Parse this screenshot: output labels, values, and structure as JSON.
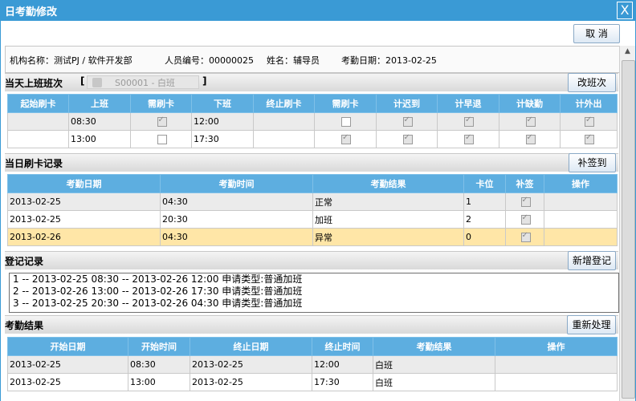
{
  "window": {
    "title": "日考勤修改",
    "close_glyph": "X"
  },
  "toolbar": {
    "cancel_label": "取 消"
  },
  "info": {
    "org": "机构名称：测试PJ / 软件开发部",
    "emp_no": "人员编号：00000025",
    "name": "姓名：辅导员",
    "date": "考勤日期：2013-02-25"
  },
  "shift": {
    "title": "当天上班班次",
    "bracket_open": "[",
    "value": "S00001 - 白班",
    "bracket_close": "]",
    "change_label": "改班次",
    "headers": [
      "起始刷卡",
      "上班",
      "需刷卡",
      "下班",
      "终止刷卡",
      "需刷卡",
      "计迟到",
      "计早退",
      "计缺勤",
      "计外出"
    ],
    "rows": [
      {
        "start_card": "",
        "on": "08:30",
        "need1": true,
        "off": "12:00",
        "end_card": "",
        "need2": false,
        "late": true,
        "early": true,
        "absent": true,
        "out": true
      },
      {
        "start_card": "",
        "on": "13:00",
        "need1": false,
        "off": "17:30",
        "end_card": "",
        "need2": true,
        "late": true,
        "early": true,
        "absent": true,
        "out": true
      }
    ]
  },
  "cards": {
    "title": "当日刷卡记录",
    "add_label": "补签到",
    "headers": [
      "考勤日期",
      "考勤时间",
      "考勤结果",
      "卡位",
      "补签",
      "操作"
    ],
    "rows": [
      {
        "date": "2013-02-25",
        "time": "04:30",
        "result": "正常",
        "slot": "1",
        "sup": true,
        "op": ""
      },
      {
        "date": "2013-02-25",
        "time": "20:30",
        "result": "加班",
        "slot": "2",
        "sup": true,
        "op": ""
      },
      {
        "date": "2013-02-26",
        "time": "04:30",
        "result": "异常",
        "slot": "0",
        "sup": true,
        "op": ""
      }
    ]
  },
  "register": {
    "title": "登记记录",
    "add_label": "新增登记",
    "items": [
      "1 -- 2013-02-25 08:30 -- 2013-02-26 12:00 申请类型:普通加班",
      "2 -- 2013-02-26 13:00 -- 2013-02-26 17:30 申请类型:普通加班",
      "3 -- 2013-02-25 20:30 -- 2013-02-26 04:30 申请类型:普通加班"
    ]
  },
  "results": {
    "title": "考勤结果",
    "reprocess_label": "重新处理",
    "headers": [
      "开始日期",
      "开始时间",
      "终止日期",
      "终止时间",
      "考勤结果",
      "操作"
    ],
    "rows": [
      {
        "sdate": "2013-02-25",
        "stime": "08:30",
        "edate": "2013-02-25",
        "etime": "12:00",
        "result": "白班",
        "op": ""
      },
      {
        "sdate": "2013-02-25",
        "stime": "13:00",
        "edate": "2013-02-25",
        "etime": "17:30",
        "result": "白班",
        "op": ""
      }
    ]
  },
  "scrollbar": {
    "up_glyph": "▲",
    "down_glyph": "▼"
  }
}
